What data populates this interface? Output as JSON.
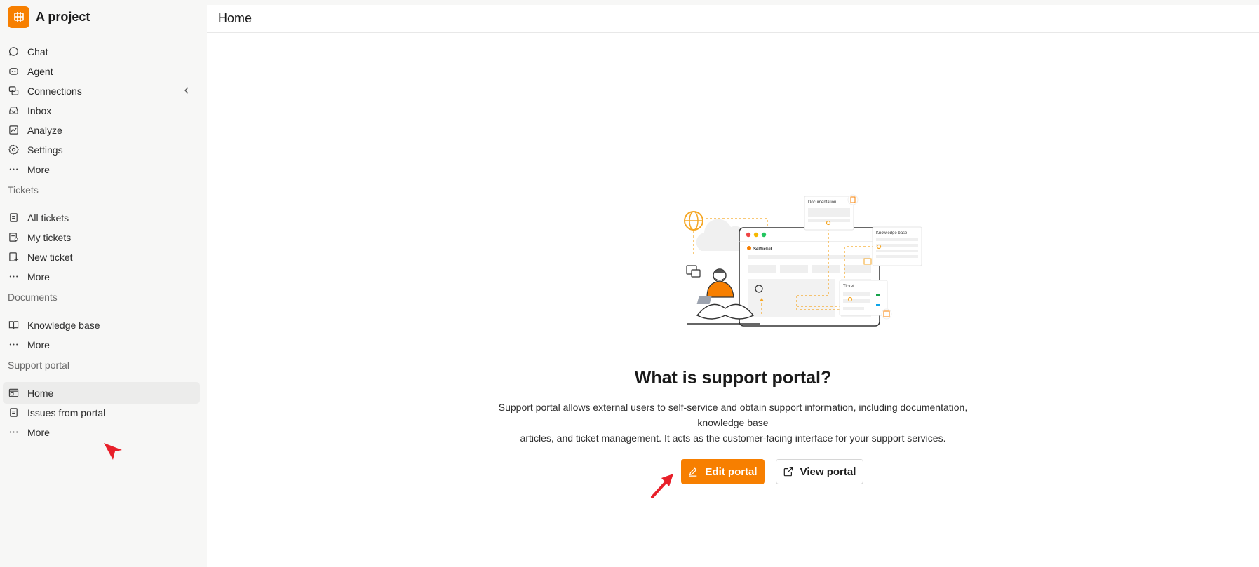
{
  "project": {
    "name": "A project",
    "logo_icon": "project-logo-icon"
  },
  "sidebar": {
    "main_items": [
      {
        "label": "Chat",
        "icon": "chat-icon"
      },
      {
        "label": "Agent",
        "icon": "agent-icon"
      },
      {
        "label": "Connections",
        "icon": "connections-icon"
      },
      {
        "label": "Inbox",
        "icon": "inbox-icon"
      },
      {
        "label": "Analyze",
        "icon": "analyze-icon"
      },
      {
        "label": "Settings",
        "icon": "settings-icon"
      },
      {
        "label": "More",
        "icon": "more-icon"
      }
    ],
    "sections": [
      {
        "title": "Tickets",
        "items": [
          {
            "label": "All tickets",
            "icon": "all-tickets-icon"
          },
          {
            "label": "My tickets",
            "icon": "my-tickets-icon"
          },
          {
            "label": "New ticket",
            "icon": "new-ticket-icon"
          },
          {
            "label": "More",
            "icon": "more-icon"
          }
        ]
      },
      {
        "title": "Documents",
        "items": [
          {
            "label": "Knowledge base",
            "icon": "book-icon"
          },
          {
            "label": "More",
            "icon": "more-icon"
          }
        ]
      },
      {
        "title": "Support portal",
        "items": [
          {
            "label": "Home",
            "icon": "portal-home-icon",
            "active": true
          },
          {
            "label": "Issues from portal",
            "icon": "issues-icon"
          },
          {
            "label": "More",
            "icon": "more-icon"
          }
        ]
      }
    ]
  },
  "header": {
    "title": "Home"
  },
  "hero": {
    "illustration_labels": {
      "documentation": "Documentation",
      "knowledge_base": "Knowledge base",
      "ticket": "Ticket",
      "brand": "Selfticket"
    },
    "title": "What is support portal?",
    "description_line1": "Support portal allows external users to self-service and obtain support information, including documentation, knowledge base",
    "description_line2": "articles, and ticket management. It acts as the customer-facing interface for your support services."
  },
  "actions": {
    "edit_label": "Edit portal",
    "view_label": "View portal"
  },
  "colors": {
    "accent": "#f77f00",
    "annotation_arrow": "#e8202a"
  }
}
